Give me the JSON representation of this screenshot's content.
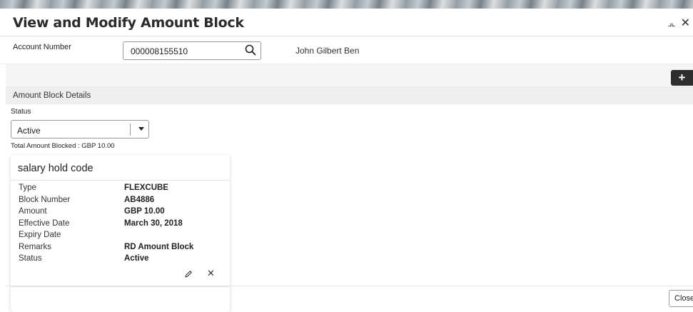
{
  "header": {
    "title": "View and Modify Amount Block",
    "minimize_icon": "⌟⌞",
    "close_icon": "✕"
  },
  "account": {
    "label": "Account Number",
    "value": "000008155510",
    "customer_name": "John Gilbert Ben"
  },
  "toolbar": {
    "add_label": "+"
  },
  "section": {
    "title": "Amount Block Details"
  },
  "status_filter": {
    "label": "Status",
    "selected": "Active"
  },
  "total_blocked": "Total Amount Blocked : GBP 10.00",
  "card": {
    "title": "salary hold code",
    "rows": [
      {
        "key": "Type",
        "value": "FLEXCUBE"
      },
      {
        "key": "Block Number",
        "value": "AB4886"
      },
      {
        "key": "Amount",
        "value": "GBP 10.00"
      },
      {
        "key": "Effective Date",
        "value": "March 30, 2018"
      },
      {
        "key": "Expiry Date",
        "value": ""
      },
      {
        "key": "Remarks",
        "value": "RD Amount Block"
      },
      {
        "key": "Status",
        "value": "Active"
      }
    ],
    "delete_icon": "✕"
  },
  "footer": {
    "close_label": "Close"
  }
}
